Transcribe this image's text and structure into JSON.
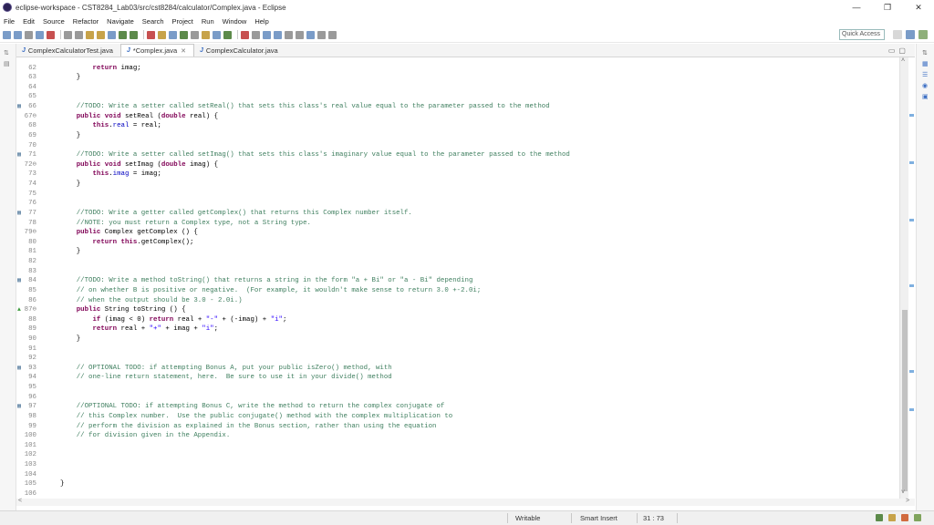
{
  "window": {
    "title": "eclipse-workspace - CST8284_Lab03/src/cst8284/calculator/Complex.java - Eclipse",
    "minimize": "—",
    "maximize": "❐",
    "close": "✕"
  },
  "menu": [
    "File",
    "Edit",
    "Source",
    "Refactor",
    "Navigate",
    "Search",
    "Project",
    "Run",
    "Window",
    "Help"
  ],
  "toolbar": {
    "quick_access": "Quick Access"
  },
  "tabs": [
    {
      "icon": "J",
      "label": "ComplexCalculatorTest.java",
      "active": false
    },
    {
      "icon": "J",
      "label": "*Complex.java",
      "active": true,
      "close": "✕"
    },
    {
      "icon": "J",
      "label": "ComplexCalculator.java",
      "active": false
    }
  ],
  "editor": {
    "lines": [
      {
        "n": "61",
        "mark": "",
        "toks": [
          [
            "tx",
            "    "
          ],
          [
            "kw",
            "public double getImag() {"
          ]
        ],
        "cut": true
      },
      {
        "n": "62",
        "mark": "",
        "toks": [
          [
            "tx",
            "        "
          ],
          [
            "kw",
            "return"
          ],
          [
            "tx",
            " imag;"
          ]
        ]
      },
      {
        "n": "63",
        "mark": "",
        "toks": [
          [
            "tx",
            "    }"
          ]
        ]
      },
      {
        "n": "64",
        "mark": "",
        "toks": []
      },
      {
        "n": "65",
        "mark": "",
        "toks": []
      },
      {
        "n": "66",
        "mark": "task",
        "toks": [
          [
            "tx",
            "    "
          ],
          [
            "cm",
            "//TODO: Write a setter called setReal() that sets this class's real value equal to the parameter passed to the method"
          ]
        ]
      },
      {
        "n": "67⊖",
        "mark": "",
        "toks": [
          [
            "tx",
            "    "
          ],
          [
            "kw",
            "public void"
          ],
          [
            "tx",
            " setReal ("
          ],
          [
            "kw",
            "double"
          ],
          [
            "tx",
            " real) {"
          ]
        ]
      },
      {
        "n": "68",
        "mark": "",
        "toks": [
          [
            "tx",
            "        "
          ],
          [
            "kw",
            "this"
          ],
          [
            "tx",
            "."
          ],
          [
            "fld",
            "real"
          ],
          [
            "tx",
            " = real;"
          ]
        ]
      },
      {
        "n": "69",
        "mark": "",
        "toks": [
          [
            "tx",
            "    }"
          ]
        ]
      },
      {
        "n": "70",
        "mark": "",
        "toks": []
      },
      {
        "n": "71",
        "mark": "task",
        "toks": [
          [
            "tx",
            "    "
          ],
          [
            "cm",
            "//TODO: Write a setter called setImag() that sets this class's imaginary value equal to the parameter passed to the method"
          ]
        ]
      },
      {
        "n": "72⊖",
        "mark": "",
        "toks": [
          [
            "tx",
            "    "
          ],
          [
            "kw",
            "public void"
          ],
          [
            "tx",
            " setImag ("
          ],
          [
            "kw",
            "double"
          ],
          [
            "tx",
            " imag) {"
          ]
        ]
      },
      {
        "n": "73",
        "mark": "",
        "toks": [
          [
            "tx",
            "        "
          ],
          [
            "kw",
            "this"
          ],
          [
            "tx",
            "."
          ],
          [
            "fld",
            "imag"
          ],
          [
            "tx",
            " = imag;"
          ]
        ]
      },
      {
        "n": "74",
        "mark": "",
        "toks": [
          [
            "tx",
            "    }"
          ]
        ]
      },
      {
        "n": "75",
        "mark": "",
        "toks": []
      },
      {
        "n": "76",
        "mark": "",
        "toks": []
      },
      {
        "n": "77",
        "mark": "task",
        "toks": [
          [
            "tx",
            "    "
          ],
          [
            "cm",
            "//TODO: Write a getter called getComplex() that returns this Complex number itself."
          ]
        ]
      },
      {
        "n": "78",
        "mark": "",
        "toks": [
          [
            "tx",
            "    "
          ],
          [
            "cm",
            "//NOTE: you must return a Complex type, not a String type."
          ]
        ]
      },
      {
        "n": "79⊖",
        "mark": "",
        "toks": [
          [
            "tx",
            "    "
          ],
          [
            "kw",
            "public"
          ],
          [
            "tx",
            " Complex getComplex () {"
          ]
        ]
      },
      {
        "n": "80",
        "mark": "",
        "toks": [
          [
            "tx",
            "        "
          ],
          [
            "kw",
            "return this"
          ],
          [
            "tx",
            ".getComplex();"
          ]
        ]
      },
      {
        "n": "81",
        "mark": "",
        "toks": [
          [
            "tx",
            "    }"
          ]
        ]
      },
      {
        "n": "82",
        "mark": "",
        "toks": []
      },
      {
        "n": "83",
        "mark": "",
        "toks": []
      },
      {
        "n": "84",
        "mark": "task",
        "toks": [
          [
            "tx",
            "    "
          ],
          [
            "cm",
            "//TODO: Write a method toString() that returns a string in the form \"a + Bi\" or \"a - Bi\" depending"
          ]
        ]
      },
      {
        "n": "85",
        "mark": "",
        "toks": [
          [
            "tx",
            "    "
          ],
          [
            "cm",
            "// on whether B is positive or negative.  (For example, it wouldn't make sense to return 3.0 +-2.0i;"
          ]
        ]
      },
      {
        "n": "86",
        "mark": "",
        "toks": [
          [
            "tx",
            "    "
          ],
          [
            "cm",
            "// when the output should be 3.0 - 2.0i.)"
          ]
        ]
      },
      {
        "n": "87⊖",
        "mark": "override",
        "toks": [
          [
            "tx",
            "    "
          ],
          [
            "kw",
            "public"
          ],
          [
            "tx",
            " String toString () {"
          ]
        ]
      },
      {
        "n": "88",
        "mark": "",
        "toks": [
          [
            "tx",
            "        "
          ],
          [
            "kw",
            "if"
          ],
          [
            "tx",
            " (imag < 0) "
          ],
          [
            "kw",
            "return"
          ],
          [
            "tx",
            " real + "
          ],
          [
            "str",
            "\"-\""
          ],
          [
            "tx",
            " + (-imag) + "
          ],
          [
            "str",
            "\"i\""
          ],
          [
            "tx",
            ";"
          ]
        ]
      },
      {
        "n": "89",
        "mark": "",
        "toks": [
          [
            "tx",
            "        "
          ],
          [
            "kw",
            "return"
          ],
          [
            "tx",
            " real + "
          ],
          [
            "str",
            "\"+\""
          ],
          [
            "tx",
            " + imag + "
          ],
          [
            "str",
            "\"i\""
          ],
          [
            "tx",
            ";"
          ]
        ]
      },
      {
        "n": "90",
        "mark": "",
        "toks": [
          [
            "tx",
            "    }"
          ]
        ]
      },
      {
        "n": "91",
        "mark": "",
        "toks": []
      },
      {
        "n": "92",
        "mark": "",
        "toks": []
      },
      {
        "n": "93",
        "mark": "task",
        "toks": [
          [
            "tx",
            "    "
          ],
          [
            "cm",
            "// OPTIONAL TODO: if attempting Bonus A, put your public isZero() method, with"
          ]
        ]
      },
      {
        "n": "94",
        "mark": "",
        "toks": [
          [
            "tx",
            "    "
          ],
          [
            "cm",
            "// one-line return statement, here.  Be sure to use it in your divide() method"
          ]
        ]
      },
      {
        "n": "95",
        "mark": "",
        "toks": []
      },
      {
        "n": "96",
        "mark": "",
        "toks": []
      },
      {
        "n": "97",
        "mark": "task",
        "toks": [
          [
            "tx",
            "    "
          ],
          [
            "cm",
            "//OPTIONAL TODO: if attempting Bonus C, write the method to return the complex conjugate of"
          ]
        ]
      },
      {
        "n": "98",
        "mark": "",
        "toks": [
          [
            "tx",
            "    "
          ],
          [
            "cm",
            "// this Complex number.  Use the public conjugate() method with the complex multiplication to"
          ]
        ]
      },
      {
        "n": "99",
        "mark": "",
        "toks": [
          [
            "tx",
            "    "
          ],
          [
            "cm",
            "// perform the division as explained in the Bonus section, rather than using the equation"
          ]
        ]
      },
      {
        "n": "100",
        "mark": "",
        "toks": [
          [
            "tx",
            "    "
          ],
          [
            "cm",
            "// for division given in the Appendix."
          ]
        ]
      },
      {
        "n": "101",
        "mark": "",
        "toks": []
      },
      {
        "n": "102",
        "mark": "",
        "toks": []
      },
      {
        "n": "103",
        "mark": "",
        "toks": []
      },
      {
        "n": "104",
        "mark": "",
        "toks": []
      },
      {
        "n": "105",
        "mark": "",
        "toks": [
          [
            "tx",
            "}"
          ]
        ]
      },
      {
        "n": "106",
        "mark": "",
        "toks": []
      }
    ]
  },
  "status": {
    "mode": "Writable",
    "insert": "Smart Insert",
    "position": "31 : 73"
  },
  "colors": {
    "keyword": "#7f0055",
    "comment": "#3f7f5f",
    "string": "#2a00ff",
    "field": "#0000c0"
  }
}
